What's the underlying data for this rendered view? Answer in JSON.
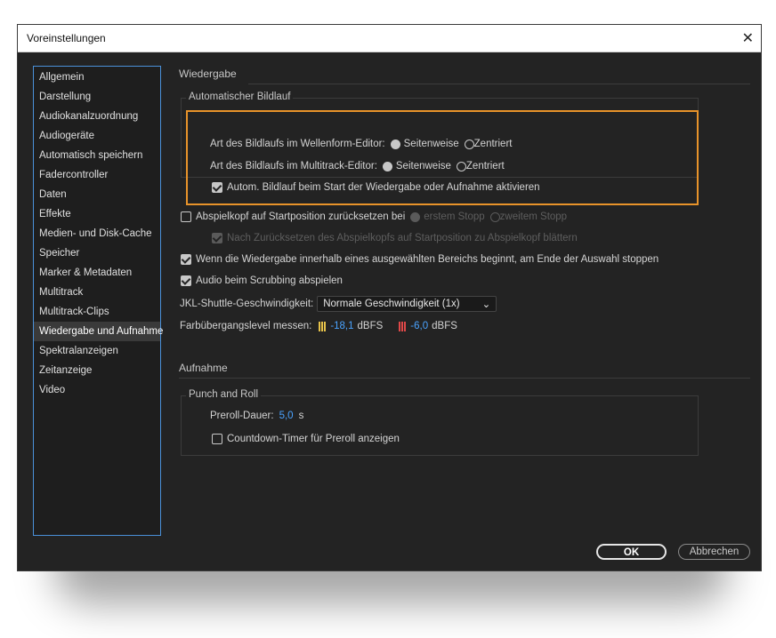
{
  "window": {
    "title": "Voreinstellungen",
    "close_glyph": "✕"
  },
  "sidebar": {
    "items": [
      {
        "label": "Allgemein"
      },
      {
        "label": "Darstellung"
      },
      {
        "label": "Audiokanalzuordnung"
      },
      {
        "label": "Audiogeräte"
      },
      {
        "label": "Automatisch speichern"
      },
      {
        "label": "Fadercontroller"
      },
      {
        "label": "Daten"
      },
      {
        "label": "Effekte"
      },
      {
        "label": "Medien- und Disk-Cache"
      },
      {
        "label": "Speicher"
      },
      {
        "label": "Marker & Metadaten"
      },
      {
        "label": "Multitrack"
      },
      {
        "label": "Multitrack-Clips"
      },
      {
        "label": "Wiedergabe und Aufnahme"
      },
      {
        "label": "Spektralanzeigen"
      },
      {
        "label": "Zeitanzeige"
      },
      {
        "label": "Video"
      }
    ],
    "selected": "Wiedergabe und Aufnahme"
  },
  "playback": {
    "section_title": "Wiedergabe",
    "auto_scroll": {
      "legend": "Automatischer Bildlauf",
      "waveform_label": "Art des Bildlaufs im Wellenform-Editor:",
      "multitrack_label": "Art des Bildlaufs im Multitrack-Editor:",
      "opt_page": "Seitenweise",
      "opt_centered": "Zentriert",
      "waveform_selected": "Seitenweise",
      "multitrack_selected": "Seitenweise",
      "autostart_label": "Autom. Bildlauf beim Start der Wiedergabe oder Aufnahme aktivieren",
      "autostart_checked": true
    },
    "reset_playhead_label": "Abspielkopf auf Startposition zurücksetzen bei",
    "reset_playhead_checked": false,
    "reset_opt_first": "erstem Stopp",
    "reset_opt_second": "zweitem Stopp",
    "scroll_to_playhead_label": "Nach Zurücksetzen des Abspielkopfs auf Startposition zu Abspielkopf blättern",
    "scroll_to_playhead_checked": true,
    "stop_at_selection_label": "Wenn die Wiedergabe innerhalb eines ausgewählten Bereichs beginnt, am Ende der Auswahl stoppen",
    "stop_at_selection_checked": true,
    "scrub_audio_label": "Audio beim Scrubbing abspielen",
    "scrub_audio_checked": true,
    "jkl_label": "JKL-Shuttle-Geschwindigkeit:",
    "jkl_value": "Normale Geschwindigkeit (1x)",
    "meter_label": "Farbübergangslevel messen:",
    "meter_yellow_value": "-18,1",
    "meter_red_value": "-6,0",
    "meter_unit": "dBFS",
    "meter_colors": {
      "yellow": "#e6c24a",
      "red": "#e04848"
    }
  },
  "recording": {
    "section_title": "Aufnahme",
    "punch": {
      "legend": "Punch and Roll",
      "preroll_label": "Preroll-Dauer:",
      "preroll_value": "5,0",
      "preroll_unit": "s",
      "countdown_label": "Countdown-Timer für Preroll anzeigen",
      "countdown_checked": false
    }
  },
  "buttons": {
    "ok": "OK",
    "cancel": "Abbrechen"
  },
  "colors": {
    "accent": "#4aa3ff",
    "highlight": "#e8932a",
    "background": "#232323"
  }
}
